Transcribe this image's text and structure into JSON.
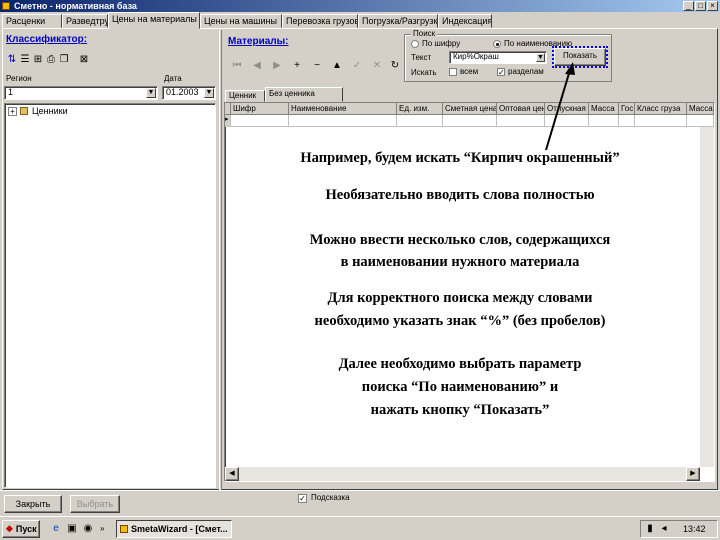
{
  "window": {
    "title": "Сметно - нормативная база"
  },
  "tabs": [
    {
      "label": "Расценки"
    },
    {
      "label": "Разведтруда"
    },
    {
      "label": "Цены на материалы"
    },
    {
      "label": "Цены на машины"
    },
    {
      "label": "Перевозка грузов"
    },
    {
      "label": "Погрузка/Разгрузка"
    },
    {
      "label": "Индексация"
    }
  ],
  "left_panel": {
    "title": "Классификатор:",
    "region_label": "Регион",
    "date_label": "Дата",
    "region_value": "1",
    "date_value": "01.2003",
    "tree_root": "Ценники"
  },
  "right_panel": {
    "title": "Материалы:",
    "search_group_title": "Поиск",
    "radio_by_code": "По шифру",
    "radio_by_name": "По наименованию",
    "text_label": "Текст",
    "text_value": "Кир%Окраш",
    "show_button": "Показать",
    "search_label": "Искать",
    "check_all": "всем",
    "check_sections": "разделам",
    "subtabs": [
      "Ценник",
      "Без ценника"
    ],
    "columns": [
      "Шифр",
      "Наименование",
      "Ед. изм.",
      "Сметная цена",
      "Оптовая цена",
      "Отпускная цена",
      "Масса",
      "Гос",
      "Класс груза",
      "Масса"
    ]
  },
  "notes": [
    "Например, будем искать “Кирпич окрашенный”",
    "Необязательно вводить слова полностью",
    "Можно ввести несколько слов, содержащихся",
    "в наименовании нужного материала",
    "Для корректного поиска между словами",
    "необходимо указать знак “%” (без пробелов)",
    "Далее необходимо выбрать параметр",
    "поиска “По наименованию” и",
    "нажать кнопку “Показать”"
  ],
  "bottom": {
    "close_button": "Закрыть",
    "select_button": "Выбрать",
    "check_label": "Подсказка"
  },
  "taskbar": {
    "start": "Пуск",
    "chevron": "»",
    "task": "SmetaWizard - [Смет...",
    "clock": "13:42"
  },
  "colors": {
    "accent_blue": "#0000c0",
    "title_bar": "#0a246a",
    "callout_box": "#0000ff"
  }
}
